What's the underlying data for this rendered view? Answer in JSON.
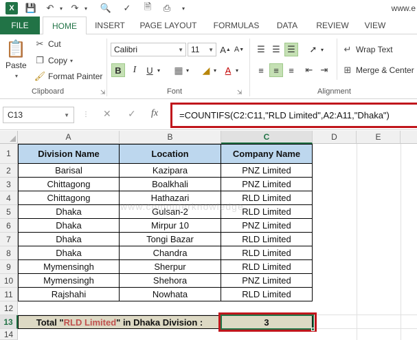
{
  "qat": {
    "app_logo": "X",
    "window_title": "www.e"
  },
  "tabs": {
    "file": "FILE",
    "home": "HOME",
    "insert": "INSERT",
    "page_layout": "PAGE LAYOUT",
    "formulas": "FORMULAS",
    "data": "DATA",
    "review": "REVIEW",
    "view": "VIEW"
  },
  "ribbon": {
    "paste": "Paste",
    "cut": "Cut",
    "copy": "Copy",
    "format_painter": "Format Painter",
    "clipboard_label": "Clipboard",
    "font_name": "Calibri",
    "font_size": "11",
    "bold": "B",
    "italic": "I",
    "underline": "U",
    "grow_font": "A",
    "shrink_font": "A",
    "font_label": "Font",
    "wrap_text": "Wrap Text",
    "merge_center": "Merge & Center",
    "alignment_label": "Alignment"
  },
  "formula_bar": {
    "name_box": "C13",
    "cancel": "✕",
    "enter": "✓",
    "fx": "fx",
    "formula": "=COUNTIFS(C2:C11,\"RLD Limited\",A2:A11,\"Dhaka\")"
  },
  "grid": {
    "columns": [
      "A",
      "B",
      "C",
      "D",
      "E"
    ],
    "rows": [
      "1",
      "2",
      "3",
      "4",
      "5",
      "6",
      "7",
      "8",
      "9",
      "10",
      "11",
      "12",
      "13",
      "14"
    ],
    "headers": [
      "Division Name",
      "Location",
      "Company Name"
    ],
    "data": [
      [
        "Barisal",
        "Kazipara",
        "PNZ Limited"
      ],
      [
        "Chittagong",
        "Boalkhali",
        "PNZ Limited"
      ],
      [
        "Chittagong",
        "Hathazari",
        "RLD Limited"
      ],
      [
        "Dhaka",
        "Gulsan-2",
        "RLD Limited"
      ],
      [
        "Dhaka",
        "Mirpur 10",
        "PNZ Limited"
      ],
      [
        "Dhaka",
        "Tongi Bazar",
        "RLD Limited"
      ],
      [
        "Dhaka",
        "Chandra",
        "RLD Limited"
      ],
      [
        "Mymensingh",
        "Sherpur",
        "RLD Limited"
      ],
      [
        "Mymensingh",
        "Shehora",
        "PNZ Limited"
      ],
      [
        "Rajshahi",
        "Nowhata",
        "RLD Limited"
      ]
    ],
    "total_prefix": "Total \"",
    "total_highlight": "RLD Limited",
    "total_suffix": "\" in Dhaka Division :",
    "total_value": "3",
    "watermark": "www.computerknowledge"
  },
  "colors": {
    "accent": "#217346",
    "header_fill": "#bdd7ee",
    "total_fill": "#ddd9c4",
    "highlight_red": "#c0161c",
    "text_red": "#c0504d"
  }
}
